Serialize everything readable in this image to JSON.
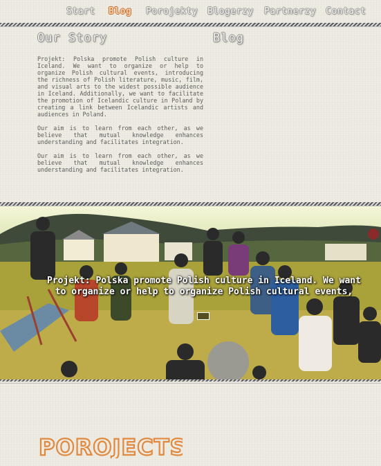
{
  "nav": {
    "items": [
      {
        "label": "Start"
      },
      {
        "label": "Blog",
        "active": true
      },
      {
        "label": "Porojekty"
      },
      {
        "label": "Blogerzy"
      },
      {
        "label": "Partnerzy"
      },
      {
        "label": "Contact"
      }
    ]
  },
  "our_story": {
    "heading": "Our Story",
    "paragraphs": [
      "Projekt: Polska promote Polish culture in Iceland. We want to organize or help to organize Polish cultural events, introducing the richness of Polish literature, music, film, and visual arts to the widest possible audience in Iceland. Additionally, we want to facilitate the promotion of Icelandic culture in Poland by creating a link between Icelandic artists and audiences in Poland.",
      "Our aim is to learn from each other, as we believe that mutual knowledge enhances understanding and facilitates integration.",
      "Our aim is to learn from each other, as we believe that mutual knowledge enhances understanding and facilitates integration."
    ]
  },
  "blog": {
    "heading": "Blog"
  },
  "banner": {
    "caption": "Projekt: Polska promote Polish culture in Iceland. We want to organize or help to organize Polish cultural events,"
  },
  "footer": {
    "logo_text": "POROJECTS"
  },
  "colors": {
    "accent": "#e0893f",
    "background": "#efece3",
    "text": "#5c5c5c"
  }
}
